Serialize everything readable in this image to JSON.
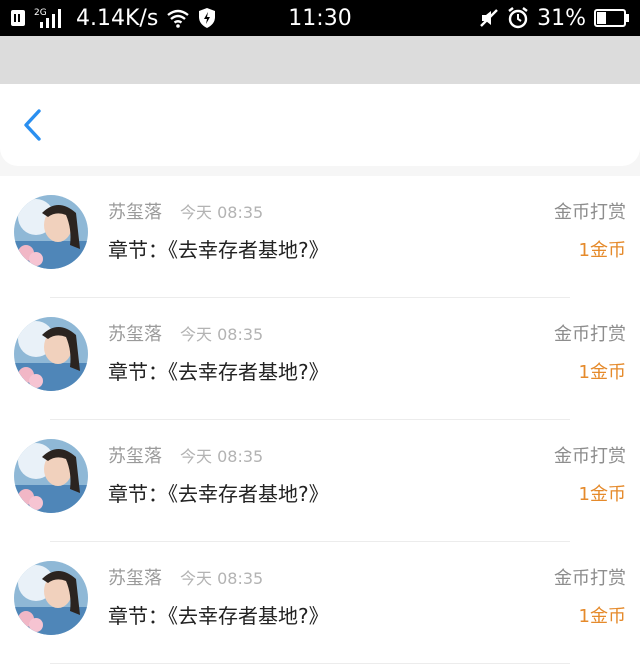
{
  "status_bar": {
    "speed": "4.14K/s",
    "network": "2G",
    "time": "11:30",
    "battery": "31%"
  },
  "header": {
    "back_icon": "chevron-left-icon",
    "accent": "#2a8ff0"
  },
  "list": {
    "items": [
      {
        "name": "苏玺落",
        "time": "今天 08:35",
        "chapter": "章节：《去幸存者基地?》",
        "reward_type": "金币打赏",
        "amount": "1金币"
      },
      {
        "name": "苏玺落",
        "time": "今天 08:35",
        "chapter": "章节：《去幸存者基地?》",
        "reward_type": "金币打赏",
        "amount": "1金币"
      },
      {
        "name": "苏玺落",
        "time": "今天 08:35",
        "chapter": "章节：《去幸存者基地?》",
        "reward_type": "金币打赏",
        "amount": "1金币"
      },
      {
        "name": "苏玺落",
        "time": "今天 08:35",
        "chapter": "章节：《去幸存者基地?》",
        "reward_type": "金币打赏",
        "amount": "1金币"
      }
    ]
  },
  "colors": {
    "amount": "#e58a2b",
    "muted": "#9a9a9a"
  }
}
